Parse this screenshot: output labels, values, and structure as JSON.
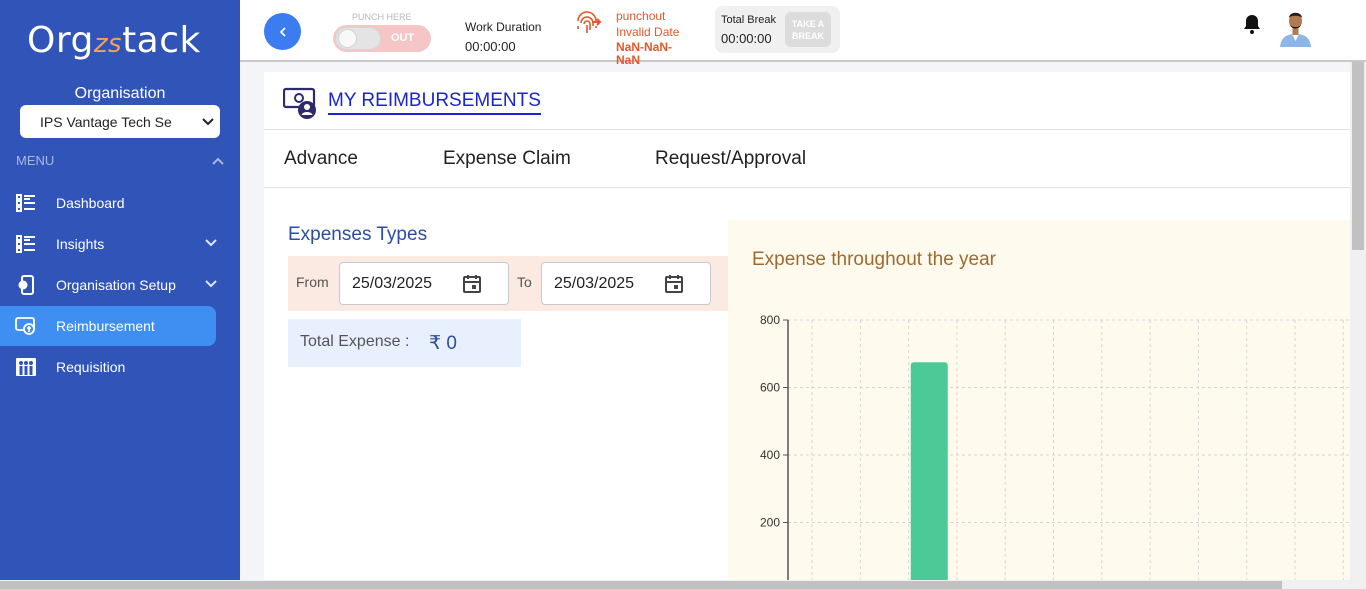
{
  "app": {
    "logo_text_a": "Org",
    "logo_text_b": "zs",
    "logo_text_c": "tack"
  },
  "sidebar": {
    "org_label": "Organisation",
    "org_selected": "IPS Vantage Tech Se",
    "menu_label": "MENU",
    "items": [
      {
        "label": "Dashboard",
        "icon": "dashboard-list-icon"
      },
      {
        "label": "Insights",
        "icon": "insights-list-icon"
      },
      {
        "label": "Organisation Setup",
        "icon": "org-setup-icon"
      },
      {
        "label": "Reimbursement",
        "icon": "reimbursement-icon"
      },
      {
        "label": "Requisition",
        "icon": "requisition-icon"
      }
    ]
  },
  "topbar": {
    "back_icon": "chevron-left-icon",
    "punch_label": "PUNCH HERE",
    "punch_state": "OUT",
    "work_duration_label": "Work Duration",
    "work_duration_value": "00:00:00",
    "punchout_label": "punchout",
    "punchout_date": "Invalid Date",
    "punchout_time": "NaN-NaN-NaN",
    "total_break_label": "Total Break",
    "total_break_value": "00:00:00",
    "take_break_label": "TAKE A BREAK"
  },
  "page": {
    "title": "MY REIMBURSEMENTS",
    "tabs": [
      "Advance",
      "Expense Claim",
      "Request/Approval"
    ],
    "section_title": "Expenses Types",
    "from_label": "From",
    "from_value": "25/03/2025",
    "to_label": "To",
    "to_value": "25/03/2025",
    "total_label": "Total Expense :",
    "total_value": "₹ 0"
  },
  "colors": {
    "sidebar": "#3054b8",
    "active_item": "#3f8ff3",
    "bar": "#4bca98",
    "chart_title": "#a0692e"
  },
  "chart_data": {
    "type": "bar",
    "title": "Expense throughout the year",
    "xlabel": "",
    "ylabel": "",
    "ylim": [
      0,
      800
    ],
    "yticks": [
      200,
      400,
      600,
      800
    ],
    "grid": true,
    "categories": [
      "",
      "",
      "",
      "",
      "",
      "",
      "",
      "",
      "",
      "",
      "",
      ""
    ],
    "values": [
      0,
      0,
      675,
      0,
      0,
      0,
      0,
      0,
      0,
      0,
      0,
      0
    ]
  }
}
